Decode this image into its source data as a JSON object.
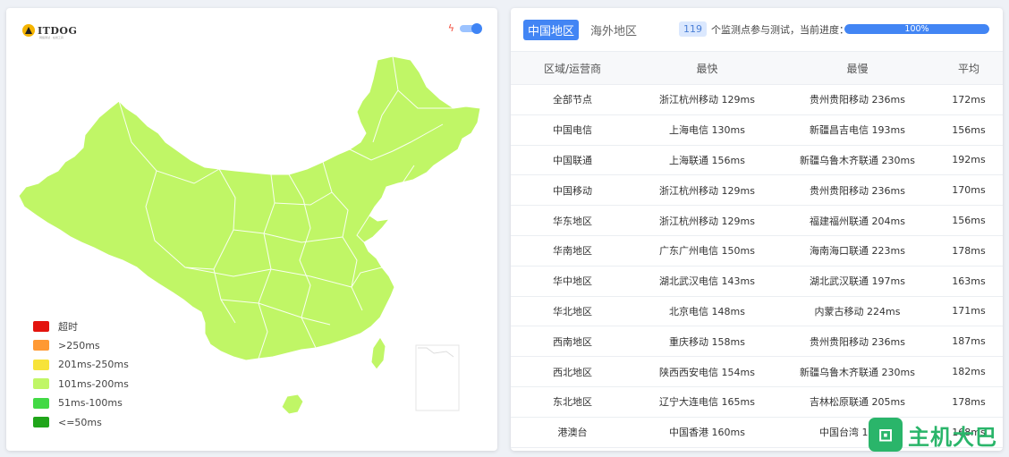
{
  "logo": {
    "text": "ITDOG",
    "sub": "网络测试 · 在线工具"
  },
  "legend": [
    {
      "label": "超时",
      "color": "#e3140e"
    },
    {
      "label": ">250ms",
      "color": "#ff9933"
    },
    {
      "label": "201ms-250ms",
      "color": "#f7e339"
    },
    {
      "label": "101ms-200ms",
      "color": "#c0f666"
    },
    {
      "label": "51ms-100ms",
      "color": "#42d945"
    },
    {
      "label": "<=50ms",
      "color": "#20a51a"
    }
  ],
  "map": {
    "fill_color": "#c0f666"
  },
  "tabs": {
    "domestic": "中国地区",
    "overseas": "海外地区"
  },
  "progress": {
    "count": "119",
    "text": "个监测点参与测试，当前进度：",
    "percent_label": "100%",
    "percent_value": 100
  },
  "table": {
    "headers": [
      "区域/运营商",
      "最快",
      "最慢",
      "平均"
    ],
    "rows": [
      [
        "全部节点",
        "浙江杭州移动 129ms",
        "贵州贵阳移动 236ms",
        "172ms"
      ],
      [
        "中国电信",
        "上海电信 130ms",
        "新疆昌吉电信 193ms",
        "156ms"
      ],
      [
        "中国联通",
        "上海联通 156ms",
        "新疆乌鲁木齐联通 230ms",
        "192ms"
      ],
      [
        "中国移动",
        "浙江杭州移动 129ms",
        "贵州贵阳移动 236ms",
        "170ms"
      ],
      [
        "华东地区",
        "浙江杭州移动 129ms",
        "福建福州联通 204ms",
        "156ms"
      ],
      [
        "华南地区",
        "广东广州电信 150ms",
        "海南海口联通 223ms",
        "178ms"
      ],
      [
        "华中地区",
        "湖北武汉电信 143ms",
        "湖北武汉联通 197ms",
        "163ms"
      ],
      [
        "华北地区",
        "北京电信 148ms",
        "内蒙古移动 224ms",
        "171ms"
      ],
      [
        "西南地区",
        "重庆移动 158ms",
        "贵州贵阳移动 236ms",
        "187ms"
      ],
      [
        "西北地区",
        "陕西西安电信 154ms",
        "新疆乌鲁木齐联通 230ms",
        "182ms"
      ],
      [
        "东北地区",
        "辽宁大连电信 165ms",
        "吉林松原联通 205ms",
        "178ms"
      ],
      [
        "港澳台",
        "中国香港 160ms",
        "中国台湾 176ms",
        "168ms"
      ]
    ]
  },
  "watermark": {
    "icon_text": "⊡",
    "text": "主机大巴"
  }
}
